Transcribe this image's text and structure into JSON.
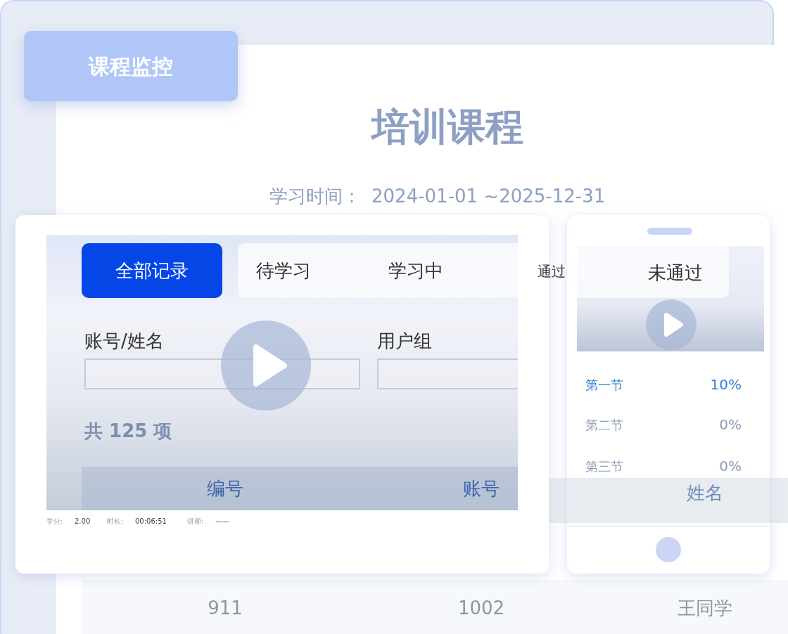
{
  "tag": "课程监控",
  "title": "培训课程",
  "study_time": {
    "label": "学习时间：",
    "value": "2024-01-01 ~2025-12-31"
  },
  "tabs": [
    {
      "label": "全部记录",
      "selected": true
    },
    {
      "label": "待学习",
      "selected": false
    },
    {
      "label": "学习中",
      "selected": false
    },
    {
      "label": "通过",
      "selected": false
    },
    {
      "label": "未通过",
      "selected": false
    }
  ],
  "filters": [
    {
      "label": "账号/姓名"
    },
    {
      "label": "用户组"
    }
  ],
  "total": "共 125 项",
  "table": {
    "columns": [
      "编号",
      "账号",
      "姓名"
    ],
    "rows": [
      [
        "911",
        "1002",
        "王同学"
      ]
    ]
  },
  "video_meta": [
    {
      "label": "学分:",
      "value": "2.00"
    },
    {
      "label": "时长:",
      "value": "00:06:51"
    },
    {
      "label": "讲师:",
      "value": "——"
    }
  ],
  "chapters": [
    {
      "name": "第一节",
      "progress": "10%",
      "selected": true
    },
    {
      "name": "第二节",
      "progress": "0%",
      "selected": false
    },
    {
      "name": "第三节",
      "progress": "0%",
      "selected": false
    }
  ]
}
